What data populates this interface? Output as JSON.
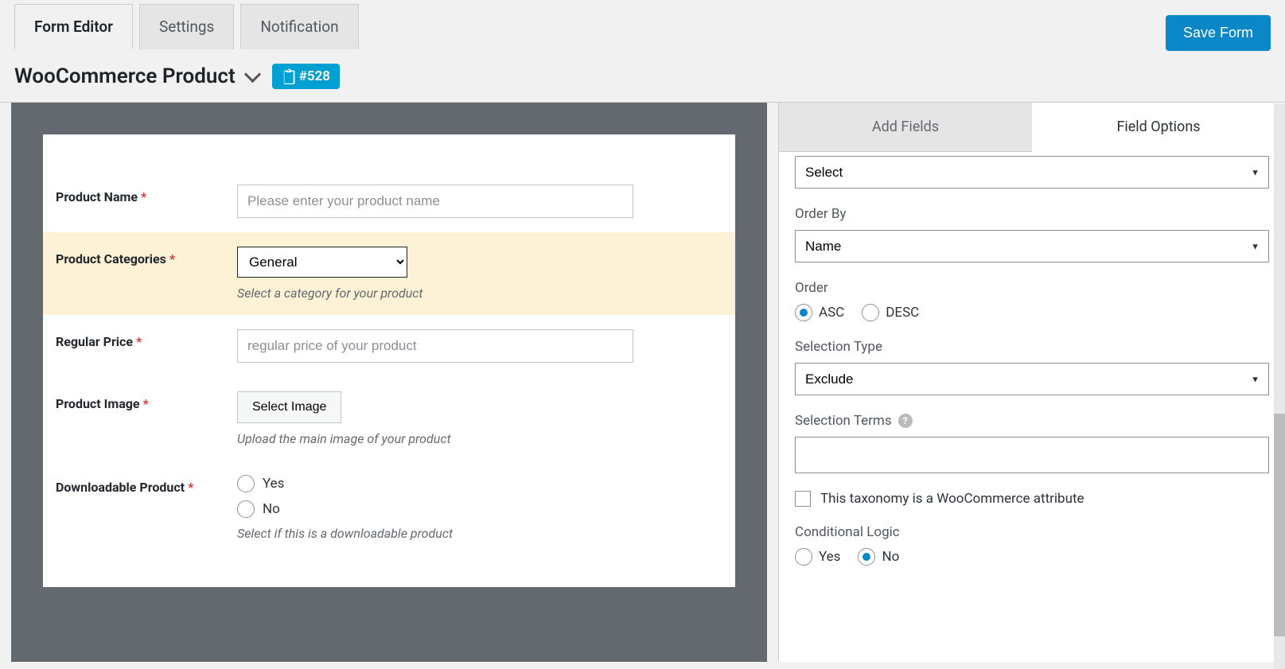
{
  "tabs": {
    "form_editor": "Form Editor",
    "settings": "Settings",
    "notification": "Notification"
  },
  "save_button": "Save Form",
  "header": {
    "title": "WooCommerce Product",
    "id_label": "#528"
  },
  "form": {
    "product_name": {
      "label": "Product Name",
      "placeholder": "Please enter your product name"
    },
    "product_categories": {
      "label": "Product Categories",
      "value": "General",
      "help": "Select a category for your product"
    },
    "regular_price": {
      "label": "Regular Price",
      "placeholder": "regular price of your product"
    },
    "product_image": {
      "label": "Product Image",
      "button": "Select Image",
      "help": "Upload the main image of your product"
    },
    "downloadable": {
      "label": "Downloadable Product",
      "options": {
        "yes": "Yes",
        "no": "No"
      },
      "help": "Select if this is a downloadable product"
    }
  },
  "sidebar": {
    "tabs": {
      "add_fields": "Add Fields",
      "field_options": "Field Options"
    },
    "first_select_value": "Select",
    "order_by": {
      "label": "Order By",
      "value": "Name"
    },
    "order": {
      "label": "Order",
      "asc": "ASC",
      "desc": "DESC",
      "selected": "asc"
    },
    "selection_type": {
      "label": "Selection Type",
      "value": "Exclude"
    },
    "selection_terms": {
      "label": "Selection Terms",
      "value": ""
    },
    "woo_attr_checkbox": "This taxonomy is a WooCommerce attribute",
    "conditional": {
      "label": "Conditional Logic",
      "yes": "Yes",
      "no": "No",
      "selected": "no"
    }
  }
}
